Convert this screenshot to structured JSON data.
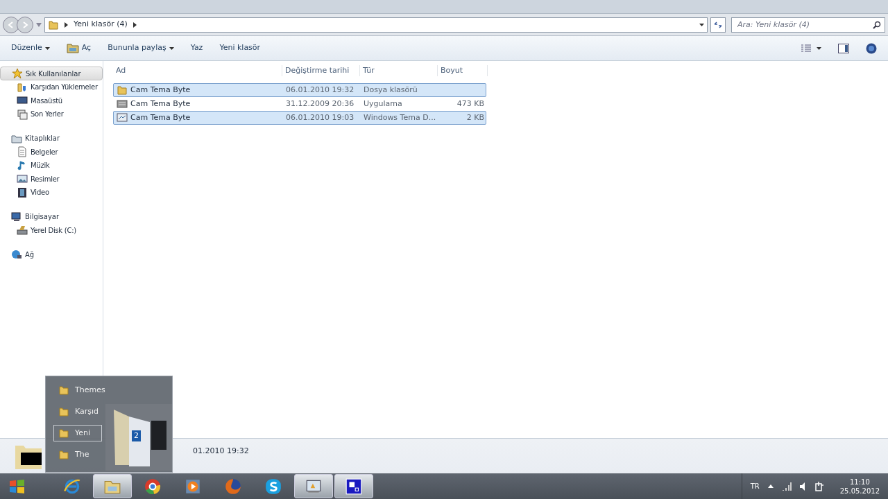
{
  "address_bar": {
    "segments": [
      "Yeni klasör (4)"
    ]
  },
  "search": {
    "placeholder": "Ara: Yeni klasör (4)"
  },
  "toolbar": {
    "buttons": [
      {
        "label": "Düzenle",
        "dropdown": true,
        "kind": "text"
      },
      {
        "label": "Aç",
        "dropdown": false,
        "kind": "open"
      },
      {
        "label": "Bununla paylaş",
        "dropdown": true,
        "kind": "text"
      },
      {
        "label": "Yaz",
        "dropdown": false,
        "kind": "text"
      },
      {
        "label": "Yeni klasör",
        "dropdown": false,
        "kind": "text"
      }
    ]
  },
  "sidebar": {
    "groups": [
      {
        "label": "Sık Kullanılanlar",
        "kind": "star",
        "selected": true,
        "children": [
          {
            "label": "Karşıdan Yüklemeler",
            "kind": "download"
          },
          {
            "label": "Masaüstü",
            "kind": "desktop"
          },
          {
            "label": "Son Yerler",
            "kind": "recent"
          }
        ]
      },
      {
        "label": "Kitaplıklar",
        "kind": "library",
        "selected": false,
        "children": [
          {
            "label": "Belgeler",
            "kind": "document"
          },
          {
            "label": "Müzik",
            "kind": "music"
          },
          {
            "label": "Resimler",
            "kind": "picture"
          },
          {
            "label": "Video",
            "kind": "video"
          }
        ]
      },
      {
        "label": "Bilgisayar",
        "kind": "computer",
        "selected": false,
        "children": [
          {
            "label": "Yerel Disk (C:)",
            "kind": "disk"
          }
        ]
      },
      {
        "label": "Ağ",
        "kind": "network",
        "selected": false
      }
    ]
  },
  "table": {
    "columns": [
      "Ad",
      "Değiştirme tarihi",
      "Tür",
      "Boyut"
    ],
    "rows": [
      {
        "kind": "folder",
        "selected": true,
        "cells": [
          "Cam Tema Byte",
          "06.01.2010 19:32",
          "Dosya klasörü",
          ""
        ]
      },
      {
        "kind": "app",
        "selected": false,
        "cells": [
          "Cam Tema Byte",
          "31.12.2009 20:36",
          "Uygulama",
          "473 KB"
        ]
      },
      {
        "kind": "theme",
        "selected": true,
        "cells": [
          "Cam Tema Byte",
          "06.01.2010 19:03",
          "Windows Tema D...",
          "2 KB"
        ]
      }
    ]
  },
  "details_pane": {
    "text": "01.2010 19:32"
  },
  "jump_list": {
    "items": [
      {
        "label": "Themes",
        "selected": false
      },
      {
        "label": "Karşıd",
        "selected": false
      },
      {
        "label": "Yeni",
        "selected": true
      },
      {
        "label": "The",
        "selected": false
      }
    ],
    "drag_badge": "2"
  },
  "taskbar": {
    "apps": [
      {
        "kind": "ie",
        "active": false
      },
      {
        "kind": "explorer",
        "active": true
      },
      {
        "kind": "chrome",
        "active": false
      },
      {
        "kind": "media",
        "active": false
      },
      {
        "kind": "firefox",
        "active": false
      },
      {
        "kind": "skype",
        "active": false
      },
      {
        "kind": "window",
        "active": true
      },
      {
        "kind": "blue",
        "active": true
      }
    ],
    "language": "TR",
    "time": "11:10",
    "date": "25.05.2012"
  }
}
